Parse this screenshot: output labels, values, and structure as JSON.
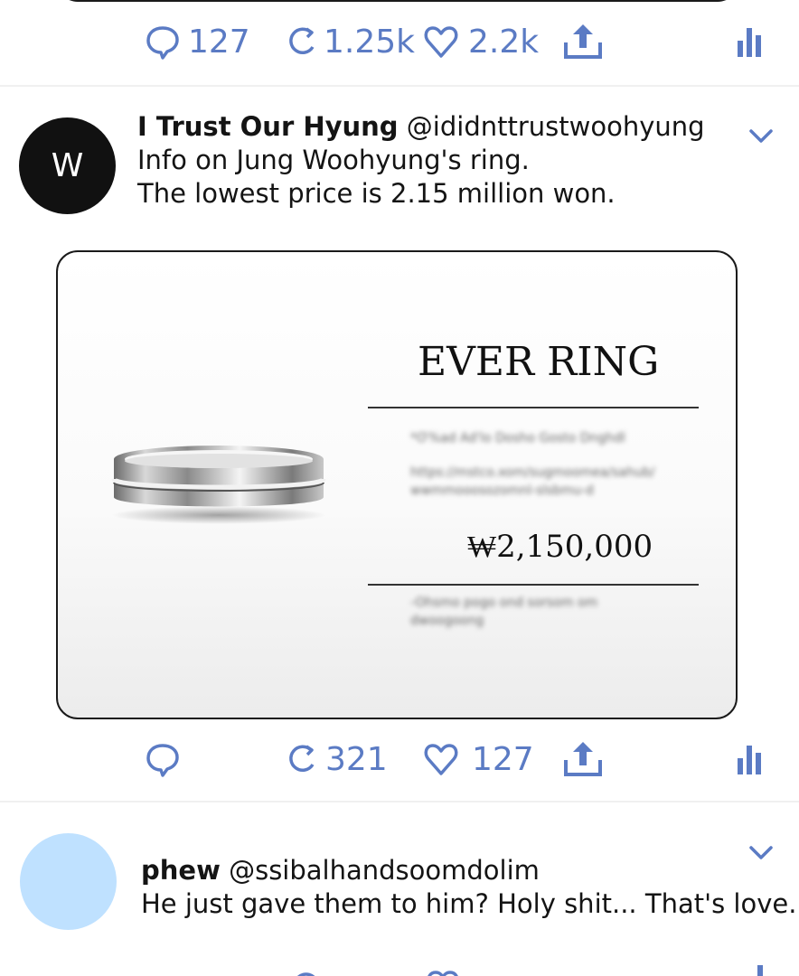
{
  "top_actions": {
    "reply_count": "127",
    "retweet_count": "1.25k",
    "like_count": "2.2k"
  },
  "tweet1": {
    "avatar_letter": "W",
    "name": "I Trust Our Hyung",
    "handle": "@ididnttrustwoohyung",
    "text_line1": "Info on Jung Woohyung's ring.",
    "text_line2": "The lowest price is 2.15 million won.",
    "media": {
      "title": "EVER RING",
      "blurred_line1": "*Ơ%ad Ad'lo Dosho Gosto Dnghdl",
      "blurred_line2": "https://mstco.xom/sugmoomea/sahub/",
      "blurred_line3": "wwmmooosozomnl-slsbmu-d",
      "price": "₩2,150,000",
      "blurred_line4": "-Ohsmo pogo ond sorsom om",
      "blurred_line5": "dwoogoong"
    },
    "actions": {
      "retweet_count": "321",
      "like_count": "127"
    }
  },
  "tweet2": {
    "name": "phew",
    "handle": "@ssibalhandsoomdolim",
    "text": "He just gave them to him? Holy shit... That's love."
  },
  "colors": {
    "action_blue": "#5b7bc4",
    "avatar_black": "#111111",
    "avatar_blue": "#bfe1ff",
    "separator": "#f0f0f0"
  }
}
